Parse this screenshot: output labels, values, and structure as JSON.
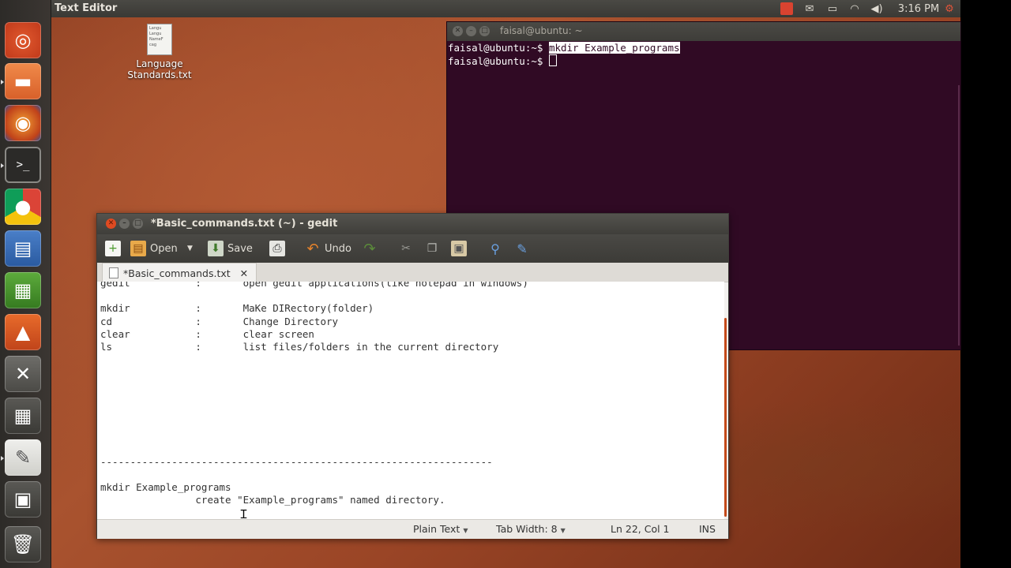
{
  "top_panel": {
    "title": "Text Editor",
    "clock": "3:16 PM",
    "icons": [
      "record-indicator",
      "mail-icon",
      "battery-icon",
      "wifi-icon",
      "volume-icon",
      "settings-gear-icon"
    ]
  },
  "launcher": {
    "items": [
      "Dash Home",
      "Files",
      "Firefox",
      "Terminal",
      "Chrome",
      "LibreOffice Writer",
      "LibreOffice Calc",
      "Ubuntu Software Center",
      "System Settings",
      "Calculator",
      "Text Editor",
      "Workspace Switcher",
      "Trash"
    ]
  },
  "desktop_icon": {
    "label": "Language Standards.txt",
    "thumb_text": "Langu Langu NameF cag"
  },
  "terminal": {
    "title": "faisal@ubuntu: ~",
    "prompt": "faisal@ubuntu:~$ ",
    "command": "mkdir Example_programs",
    "prompt2": "faisal@ubuntu:~$ "
  },
  "gedit": {
    "title": "*Basic_commands.txt (~) - gedit",
    "toolbar": {
      "open_label": "Open",
      "save_label": "Save",
      "undo_label": "Undo"
    },
    "tab_label": "*Basic_commands.txt",
    "content": "gedit           :       open gedit applications(like notepad in windows)\n\nmkdir           :       MaKe DIRectory(folder)\ncd              :       Change Directory\nclear           :       clear screen\nls              :       list files/folders in the current directory\n\n\n\n\n\n\n\n\n------------------------------------------------------------------\n\nmkdir Example_programs\n                create \"Example_programs\" named directory.",
    "status": {
      "language": "Plain Text",
      "tab_width": "Tab Width: 8",
      "position": "Ln 22, Col 1",
      "mode": "INS"
    }
  },
  "colors": {
    "terminal_bg": "#300a24",
    "panel_bg": "#3c3b37",
    "accent": "#df4a21"
  }
}
